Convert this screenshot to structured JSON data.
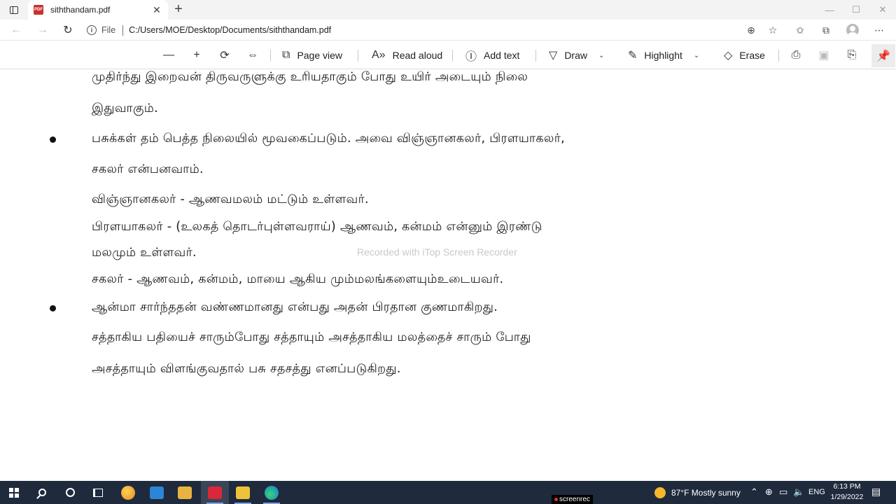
{
  "browser": {
    "tab": {
      "title": "siththandam.pdf",
      "favicon_text": "PDF"
    },
    "address": {
      "label": "File",
      "url": "C:/Users/MOE/Desktop/Documents/siththandam.pdf"
    }
  },
  "pdf_toolbar": {
    "zoom_out": "—",
    "zoom_in": "+",
    "page_view": "Page view",
    "read_aloud": "Read aloud",
    "add_text": "Add text",
    "draw": "Draw",
    "highlight": "Highlight",
    "erase": "Erase"
  },
  "document": {
    "lines": [
      "முதிர்ந்து இறைவன் திருவருளுக்கு உரியதாகும் போது உயிர் அடையும்  நிலை",
      "இதுவாகும்.",
      "பசுக்கள் தம் பெத்த நிலையில் மூவகைப்படும். அவை விஞ்ஞானகலர், பிரளயாகலர்,",
      "சகலர் என்பனவாம்.",
      "விஞ்ஞானகலர் - ஆணவமலம் மட்டும் உள்ளவர்.",
      "பிரளயாகலர் - (உலகத் தொடர்புள்ளவராய்) ஆணவம், கன்மம் என்னும் இரண்டு",
      "மலமும் உள்ளவர்.",
      "சகலர்  - ஆணவம், கன்மம், மாயை ஆகிய மும்மலங்களையும்உடையவர்.",
      "ஆன்மா சார்ந்ததன் வண்ணமானது  என்பது அதன் பிரதான குணமாகிறது.",
      "சத்தாகிய பதியைச் சாரும்போது சத்தாயும் அசத்தாகிய மலத்தைச் சாரும் போது",
      "அசத்தாயும் விளங்குவதால் பசு சதசத்து எனப்படுகிறது."
    ],
    "watermark": "Recorded with iTop Screen Recorder"
  },
  "taskbar": {
    "weather": "87°F  Mostly sunny",
    "language": "ENG",
    "time": "6:13 PM",
    "date": "1/29/2022",
    "screenrec": "screenrec"
  },
  "colors": {
    "taskbar": "#1f2a3c",
    "pdf_icon": "#c8302c"
  }
}
